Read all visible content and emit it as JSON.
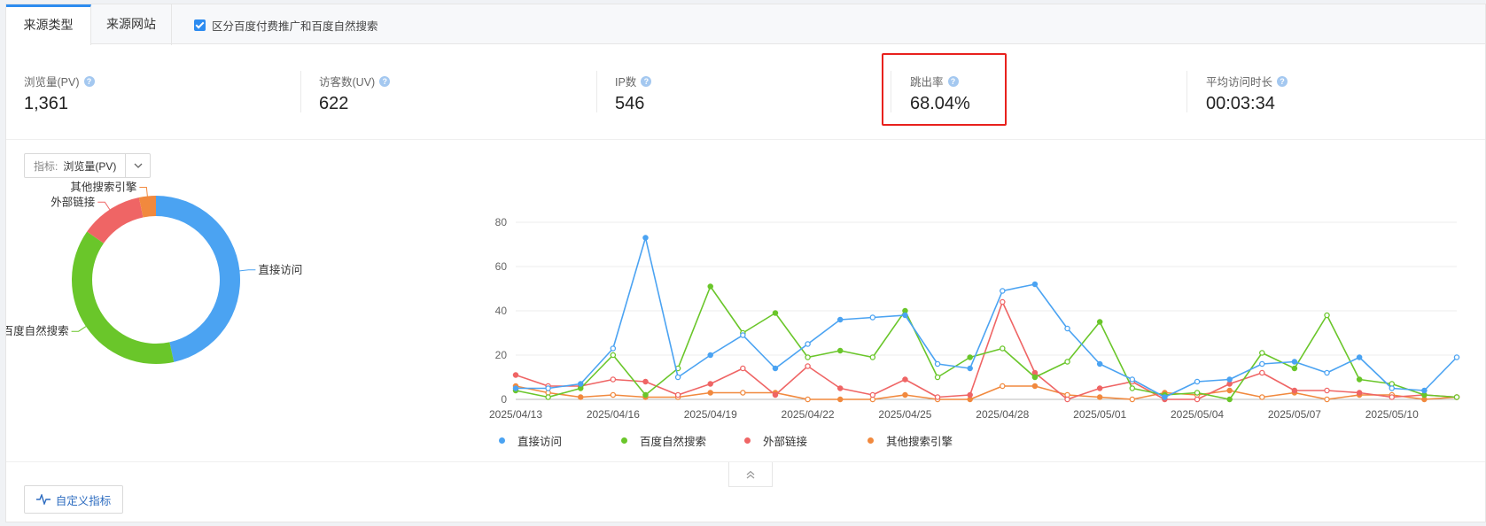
{
  "tabs": [
    {
      "label": "来源类型",
      "active": true
    },
    {
      "label": "来源网站",
      "active": false
    }
  ],
  "toggle": {
    "label": "区分百度付费推广和百度自然搜索",
    "checked": true
  },
  "metrics": [
    {
      "label": "浏览量(PV)",
      "value": "1,361"
    },
    {
      "label": "访客数(UV)",
      "value": "622"
    },
    {
      "label": "IP数",
      "value": "546"
    },
    {
      "label": "跳出率",
      "value": "68.04%"
    },
    {
      "label": "平均访问时长",
      "value": "00:03:34"
    }
  ],
  "selector": {
    "label": "指标:",
    "value": "浏览量(PV)"
  },
  "custom_button": {
    "label": "自定义指标"
  },
  "colors": {
    "direct": "#4ba3f2",
    "baidu": "#6ac62a",
    "external": "#ef6565",
    "other": "#f1893e",
    "accent": "#2d8cf0",
    "highlight": "#e8211d"
  },
  "chart_data": [
    {
      "type": "pie",
      "donut": true,
      "slices": [
        {
          "label": "直接访问",
          "value": 634
        },
        {
          "label": "百度自然搜索",
          "value": 519
        },
        {
          "label": "外部链接",
          "value": 164
        },
        {
          "label": "其他搜索引擎",
          "value": 44
        }
      ]
    },
    {
      "type": "line",
      "x": [
        "2025/04/13",
        "2025/04/14",
        "2025/04/15",
        "2025/04/16",
        "2025/04/17",
        "2025/04/18",
        "2025/04/19",
        "2025/04/20",
        "2025/04/21",
        "2025/04/22",
        "2025/04/23",
        "2025/04/24",
        "2025/04/25",
        "2025/04/26",
        "2025/04/27",
        "2025/04/28",
        "2025/04/29",
        "2025/04/30",
        "2025/05/01",
        "2025/05/02",
        "2025/05/03",
        "2025/05/04",
        "2025/05/05",
        "2025/05/06",
        "2025/05/07",
        "2025/05/08",
        "2025/05/09",
        "2025/05/10",
        "2025/05/11",
        "2025/05/12"
      ],
      "xticks": [
        "2025/04/13",
        "2025/04/16",
        "2025/04/19",
        "2025/04/22",
        "2025/04/25",
        "2025/04/28",
        "2025/05/01",
        "2025/05/04",
        "2025/05/07",
        "2025/05/10"
      ],
      "ylim": [
        0,
        80
      ],
      "yticks": [
        0,
        20,
        40,
        60,
        80
      ],
      "grid": true,
      "legend": "bottom",
      "series": [
        {
          "name": "直接访问",
          "values": [
            5,
            5,
            7,
            23,
            73,
            10,
            20,
            29,
            14,
            25,
            36,
            37,
            38,
            16,
            14,
            49,
            52,
            32,
            16,
            9,
            1,
            8,
            9,
            16,
            17,
            12,
            19,
            5,
            4,
            19
          ]
        },
        {
          "name": "百度自然搜索",
          "values": [
            4,
            1,
            5,
            20,
            2,
            14,
            51,
            30,
            39,
            19,
            22,
            19,
            40,
            10,
            19,
            23,
            10,
            17,
            35,
            5,
            2,
            3,
            0,
            21,
            14,
            38,
            9,
            7,
            2,
            1
          ]
        },
        {
          "name": "外部链接",
          "values": [
            11,
            6,
            6,
            9,
            8,
            2,
            7,
            14,
            2,
            15,
            5,
            2,
            9,
            1,
            2,
            44,
            12,
            0,
            5,
            8,
            0,
            0,
            7,
            12,
            4,
            4,
            3,
            1,
            2,
            1
          ]
        },
        {
          "name": "其他搜索引擎",
          "values": [
            6,
            3,
            1,
            2,
            1,
            1,
            3,
            3,
            3,
            0,
            0,
            0,
            2,
            0,
            0,
            6,
            6,
            2,
            1,
            0,
            3,
            2,
            4,
            1,
            3,
            0,
            2,
            2,
            0,
            1
          ]
        }
      ]
    }
  ]
}
